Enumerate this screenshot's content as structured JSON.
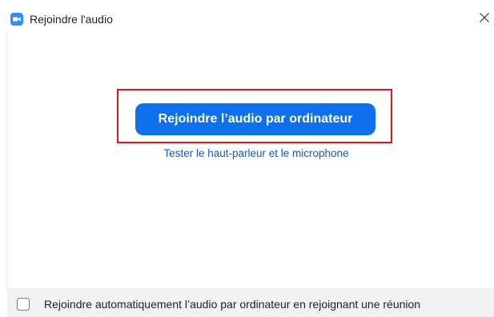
{
  "window": {
    "title": "Rejoindre l'audio",
    "icon": "zoom-camera-icon",
    "close_icon": "close-icon"
  },
  "main": {
    "join_button_label": "Rejoindre l’audio par ordinateur",
    "test_link_label": "Tester le haut-parleur et le microphone"
  },
  "footer": {
    "auto_join_label": "Rejoindre automatiquement l’audio par ordinateur en rejoignant une réunion",
    "auto_join_checked": false
  },
  "colors": {
    "accent": "#0e71eb",
    "link": "#0e5cc4",
    "highlight": "#e0161b",
    "footer_bg": "#f2f2f4"
  }
}
